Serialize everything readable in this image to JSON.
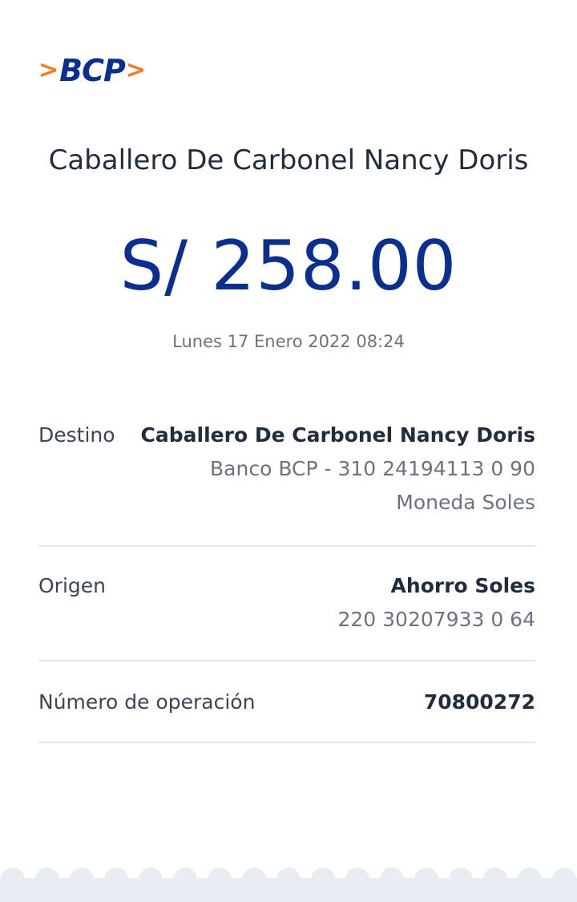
{
  "logo": {
    "left_chevron": ">",
    "brand": "BCP",
    "right_chevron": ">"
  },
  "payee_name": "Caballero De Carbonel Nancy Doris",
  "amount": "S/ 258.00",
  "datetime": "Lunes 17 Enero 2022 08:24",
  "details": {
    "destino": {
      "label": "Destino",
      "name": "Caballero De Carbonel Nancy Doris",
      "account": "Banco BCP - 310 24194113 0 90",
      "currency": "Moneda Soles"
    },
    "origen": {
      "label": "Origen",
      "account_type": "Ahorro Soles",
      "account": "220 30207933 0 64"
    },
    "operacion": {
      "label": "Número de operación",
      "number": "70800272"
    }
  },
  "colors": {
    "brand_blue": "#0a2f8f",
    "brand_orange": "#f47b20",
    "footer_bg": "#e8edf4"
  }
}
